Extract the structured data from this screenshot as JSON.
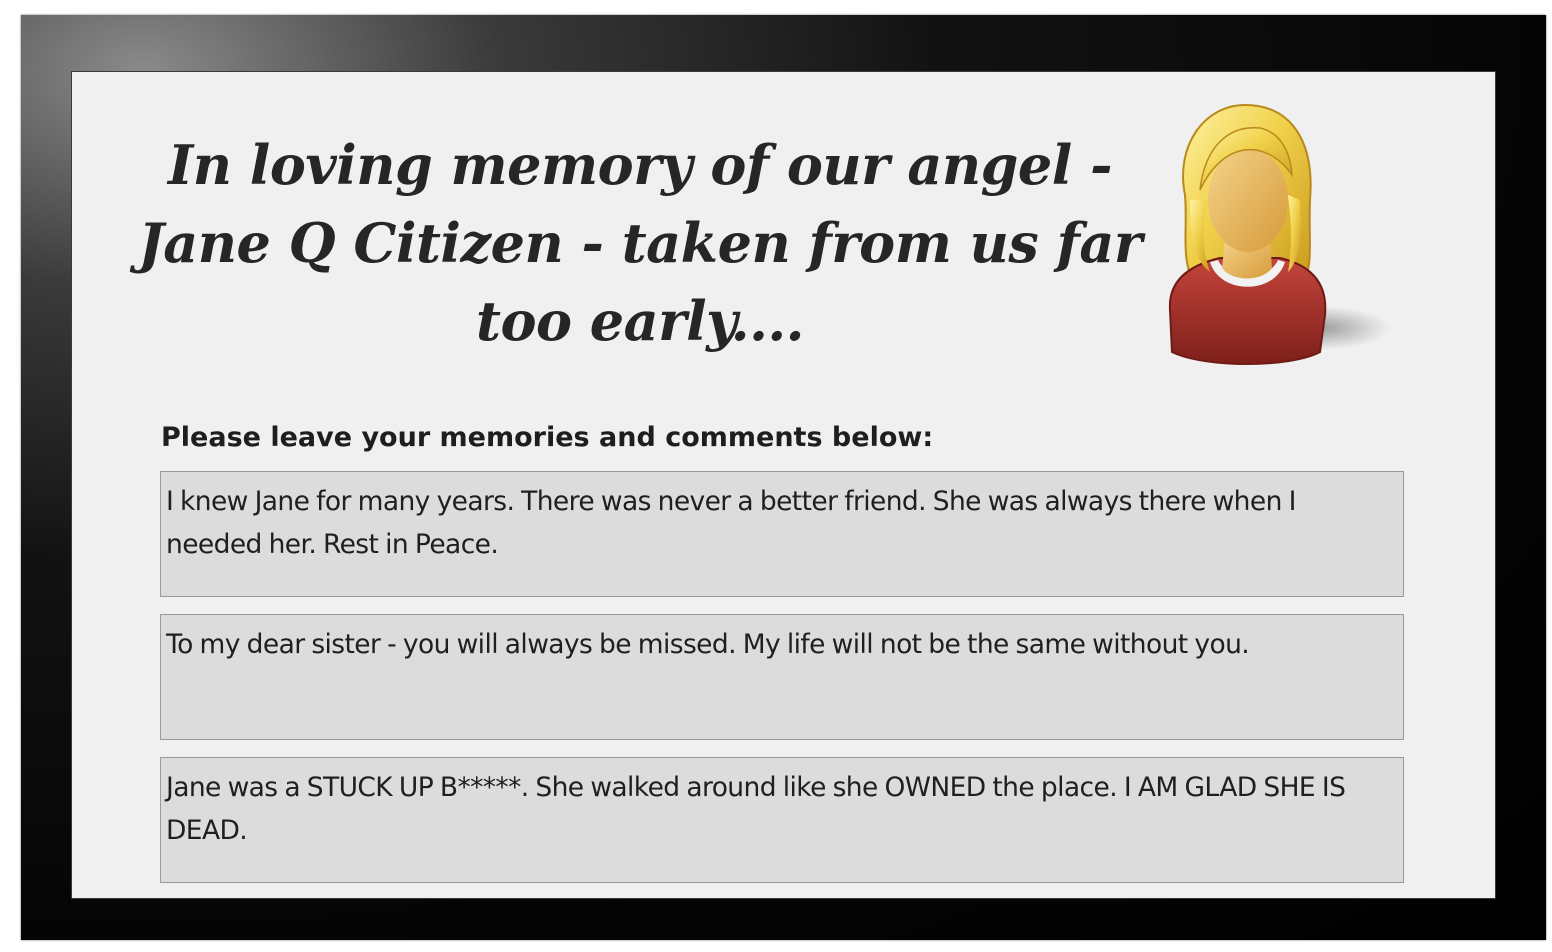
{
  "memorial": {
    "title": "In loving memory of our angel - Jane Q Citizen - taken from us far too early....",
    "prompt": "Please leave your memories and comments below:"
  },
  "avatar": {
    "icon": "woman-avatar-icon",
    "hair_color": "#e9c53a",
    "shirt_color": "#a8302a",
    "skin_color": "#e6b45a"
  },
  "comments": [
    {
      "text": "I knew Jane for many years. There was never a better friend. She was always there when I needed her. Rest in Peace."
    },
    {
      "text": "To my dear sister - you will always be missed. My life will not be the same without you."
    },
    {
      "text": "Jane was a STUCK UP B*****. She walked around like she OWNED the place. I AM GLAD SHE IS DEAD."
    }
  ]
}
